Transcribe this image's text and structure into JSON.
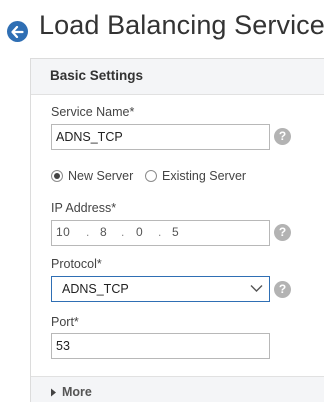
{
  "page": {
    "title": "Load Balancing Service"
  },
  "panel": {
    "title": "Basic Settings",
    "service_name": {
      "label": "Service Name*",
      "value": "ADNS_TCP"
    },
    "server_type": {
      "options": [
        {
          "label": "New Server",
          "selected": true
        },
        {
          "label": "Existing Server",
          "selected": false
        }
      ]
    },
    "ip_address": {
      "label": "IP Address*",
      "octets": [
        "10",
        "8",
        "0",
        "5"
      ],
      "separator": "."
    },
    "protocol": {
      "label": "Protocol*",
      "selected": "ADNS_TCP"
    },
    "port": {
      "label": "Port*",
      "value": "53"
    },
    "help_glyph": "?",
    "more_label": "More"
  },
  "colors": {
    "accent": "#2f6fb4",
    "panel_header_bg": "#f4f5f7",
    "help_icon_bg": "#b3b3b3"
  },
  "icons": {
    "back": "arrow-left-circle-icon",
    "help": "question-circle-icon",
    "dropdown": "chevron-down-icon",
    "expand": "caret-right-icon"
  }
}
